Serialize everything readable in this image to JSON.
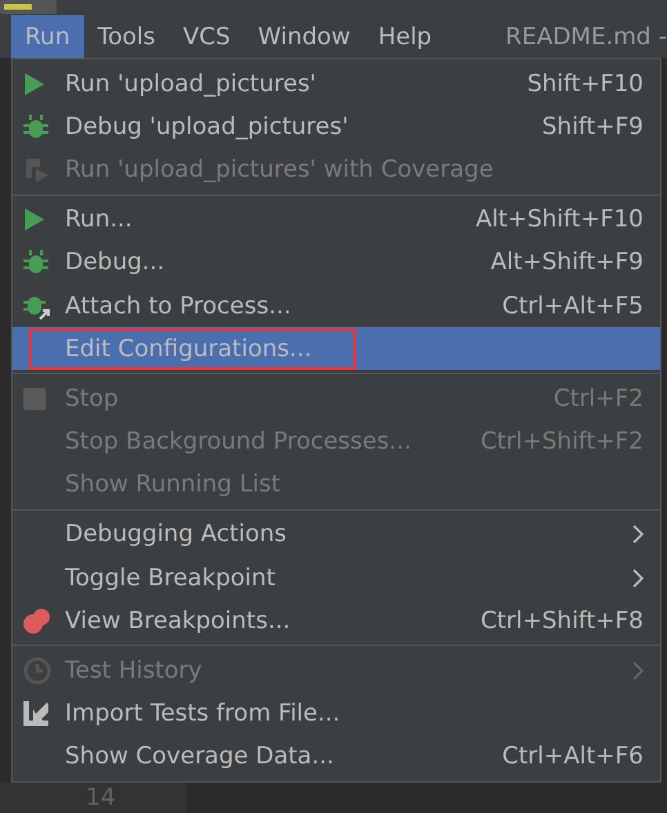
{
  "menubar": {
    "items": [
      {
        "label": "Run",
        "selected": true
      },
      {
        "label": "Tools",
        "selected": false
      },
      {
        "label": "VCS",
        "selected": false
      },
      {
        "label": "Window",
        "selected": false
      },
      {
        "label": "Help",
        "selected": false
      }
    ],
    "file_tab": "README.md -"
  },
  "menu": {
    "groups": [
      {
        "items": [
          {
            "kind": "run",
            "label": "Run 'upload_pictures'",
            "shortcut": "Shift+F10",
            "disabled": false,
            "selected": false
          },
          {
            "kind": "debug",
            "label": "Debug 'upload_pictures'",
            "shortcut": "Shift+F9",
            "disabled": false,
            "selected": false
          },
          {
            "kind": "coverage",
            "label": "Run 'upload_pictures' with Coverage",
            "disabled": true,
            "selected": false
          }
        ]
      },
      {
        "items": [
          {
            "kind": "run",
            "label": "Run...",
            "shortcut": "Alt+Shift+F10",
            "disabled": false,
            "selected": false
          },
          {
            "kind": "debug",
            "label": "Debug...",
            "shortcut": "Alt+Shift+F9",
            "disabled": false,
            "selected": false
          },
          {
            "kind": "attach",
            "label": "Attach to Process...",
            "shortcut": "Ctrl+Alt+F5",
            "disabled": false,
            "selected": false
          },
          {
            "label": "Edit Configurations...",
            "disabled": false,
            "selected": true,
            "outlined": true
          }
        ]
      },
      {
        "items": [
          {
            "kind": "stop",
            "label": "Stop",
            "shortcut": "Ctrl+F2",
            "disabled": true,
            "selected": false
          },
          {
            "label": "Stop Background Processes...",
            "shortcut": "Ctrl+Shift+F2",
            "disabled": true,
            "selected": false
          },
          {
            "label": "Show Running List",
            "disabled": true,
            "selected": false
          }
        ]
      },
      {
        "items": [
          {
            "label": "Debugging Actions",
            "submenu": true,
            "disabled": false,
            "selected": false
          },
          {
            "label": "Toggle Breakpoint",
            "submenu": true,
            "disabled": false,
            "selected": false
          },
          {
            "kind": "breakpoints",
            "label": "View Breakpoints...",
            "shortcut": "Ctrl+Shift+F8",
            "disabled": false,
            "selected": false
          }
        ]
      },
      {
        "items": [
          {
            "kind": "history",
            "label": "Test History",
            "submenu": true,
            "disabled": true,
            "selected": false
          },
          {
            "kind": "import",
            "label": "Import Tests from File...",
            "disabled": false,
            "selected": false
          },
          {
            "label": "Show Coverage Data...",
            "shortcut": "Ctrl+Alt+F6",
            "disabled": false,
            "selected": false
          }
        ]
      }
    ]
  },
  "editor": {
    "line_number": "14"
  }
}
